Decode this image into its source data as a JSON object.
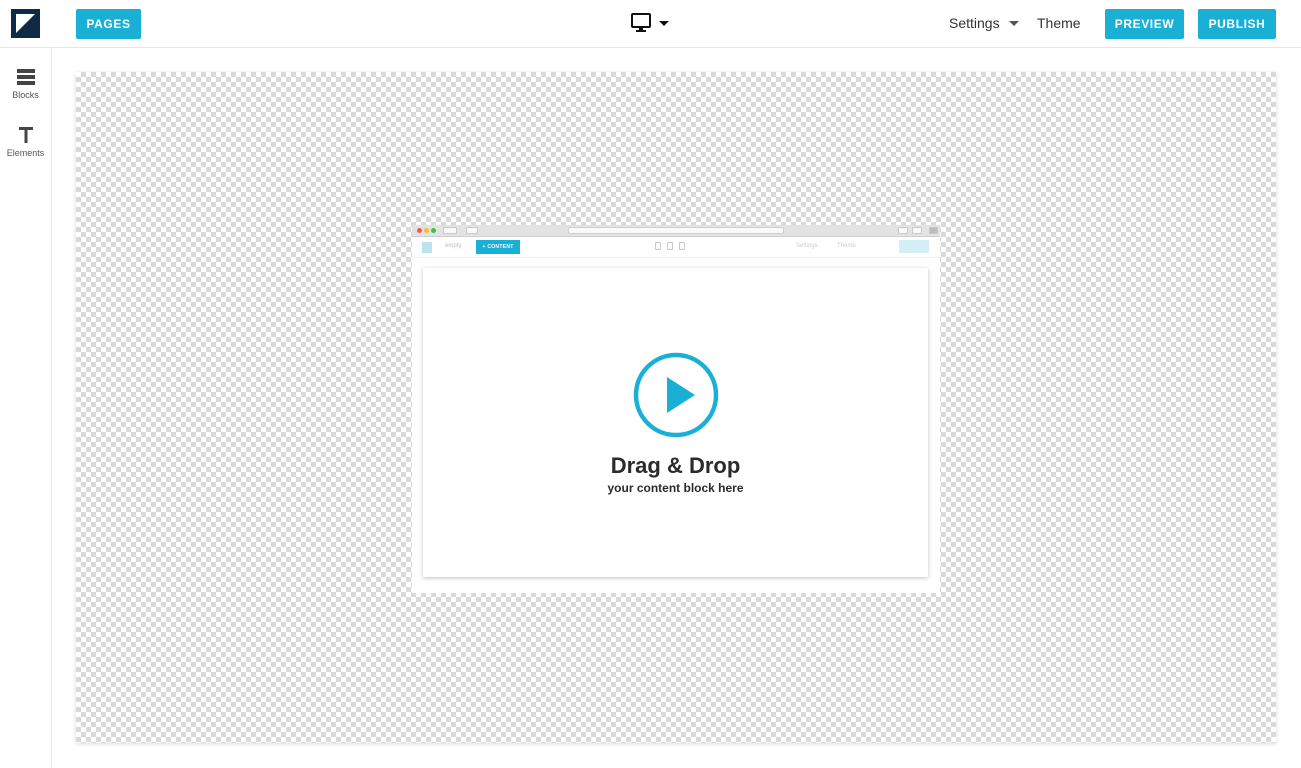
{
  "header": {
    "pages_label": "PAGES",
    "settings_label": "Settings",
    "theme_label": "Theme",
    "preview_label": "PREVIEW",
    "publish_label": "PUBLISH",
    "device_icon": "desktop-monitor-icon"
  },
  "sidebar": {
    "items": [
      {
        "label": "Blocks",
        "icon": "blocks-icon"
      },
      {
        "label": "Elements",
        "icon": "text-t-icon"
      }
    ]
  },
  "placeholder": {
    "title": "Drag & Drop",
    "subtitle": "your content block here",
    "mini_toolbar": {
      "empty_label": "empty",
      "content_label": "+ CONTENT",
      "settings_label": "Settings",
      "theme_label": "Theme"
    }
  },
  "colors": {
    "accent": "#1ab0d6",
    "logo": "#0f2a44"
  }
}
